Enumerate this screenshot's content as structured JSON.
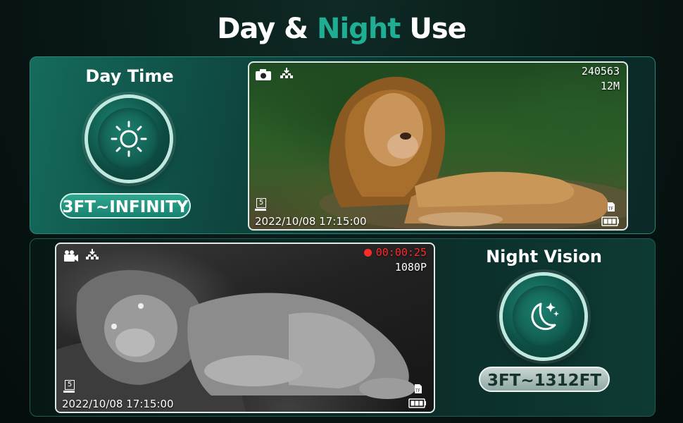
{
  "title": {
    "part1": "Day & ",
    "accent": "Night",
    "part2": " Use"
  },
  "day": {
    "label": "Day Time",
    "range": "3FT~INFINITY",
    "icon": "sun-icon",
    "screen": {
      "mode_icon": "camera-icon",
      "signal_icon": "antenna-icon",
      "photo_count": "240563",
      "resolution": "12M",
      "channel": "5",
      "datetime": "2022/10/08 17:15:00",
      "storage_icon": "tf-card-icon",
      "battery_icon": "battery-icon"
    }
  },
  "night": {
    "label": "Night Vision",
    "range": "3FT~1312FT",
    "icon": "moon-stars-icon",
    "screen": {
      "mode_icon": "video-camera-icon",
      "signal_icon": "antenna-icon",
      "rec_time": "00:00:25",
      "resolution": "1080P",
      "channel": "5",
      "datetime": "2022/10/08 17:15:00",
      "storage_icon": "tf-card-icon",
      "battery_icon": "battery-icon"
    }
  },
  "colors": {
    "accent": "#1fae93",
    "rec": "#ff2a2a"
  }
}
